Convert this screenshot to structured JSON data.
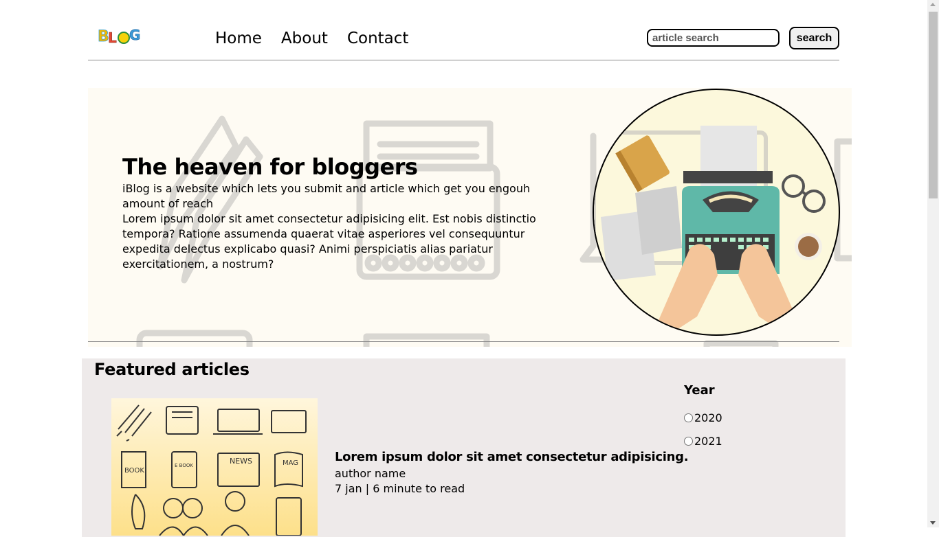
{
  "header": {
    "logo_text": "BLOG",
    "nav": [
      "Home",
      "About",
      "Contact"
    ],
    "search_placeholder": "article search",
    "search_button": "search"
  },
  "hero": {
    "title": "The heaven for bloggers",
    "paragraph1": "iBlog is a website which lets you submit and article which get you engouh amount of reach",
    "paragraph2": "Lorem ipsum dolor sit amet consectetur adipisicing elit. Est nobis distinctio tempora? Ratione assumenda quaerat vitae asperiores vel consequuntur expedita delectus explicabo quasi? Animi perspiciatis alias pariatur exercitationem, a nostrum?"
  },
  "featured": {
    "title": "Featured articles",
    "article": {
      "title": "Lorem ipsum dolor sit amet consectetur adipisicing.",
      "author": "author name",
      "meta": "7 jan | 6 minute to read",
      "image_labels": [
        "BOOK",
        "E BOOK",
        "NEWS",
        "MAG"
      ]
    },
    "filter": {
      "title": "Year",
      "options": [
        "2020",
        "2021"
      ]
    }
  },
  "colors": {
    "hero_bg": "#fefbf3",
    "featured_bg": "#eeeaea",
    "circle_bg": "#fcf8dc",
    "typewriter": "#5fb8a8"
  }
}
